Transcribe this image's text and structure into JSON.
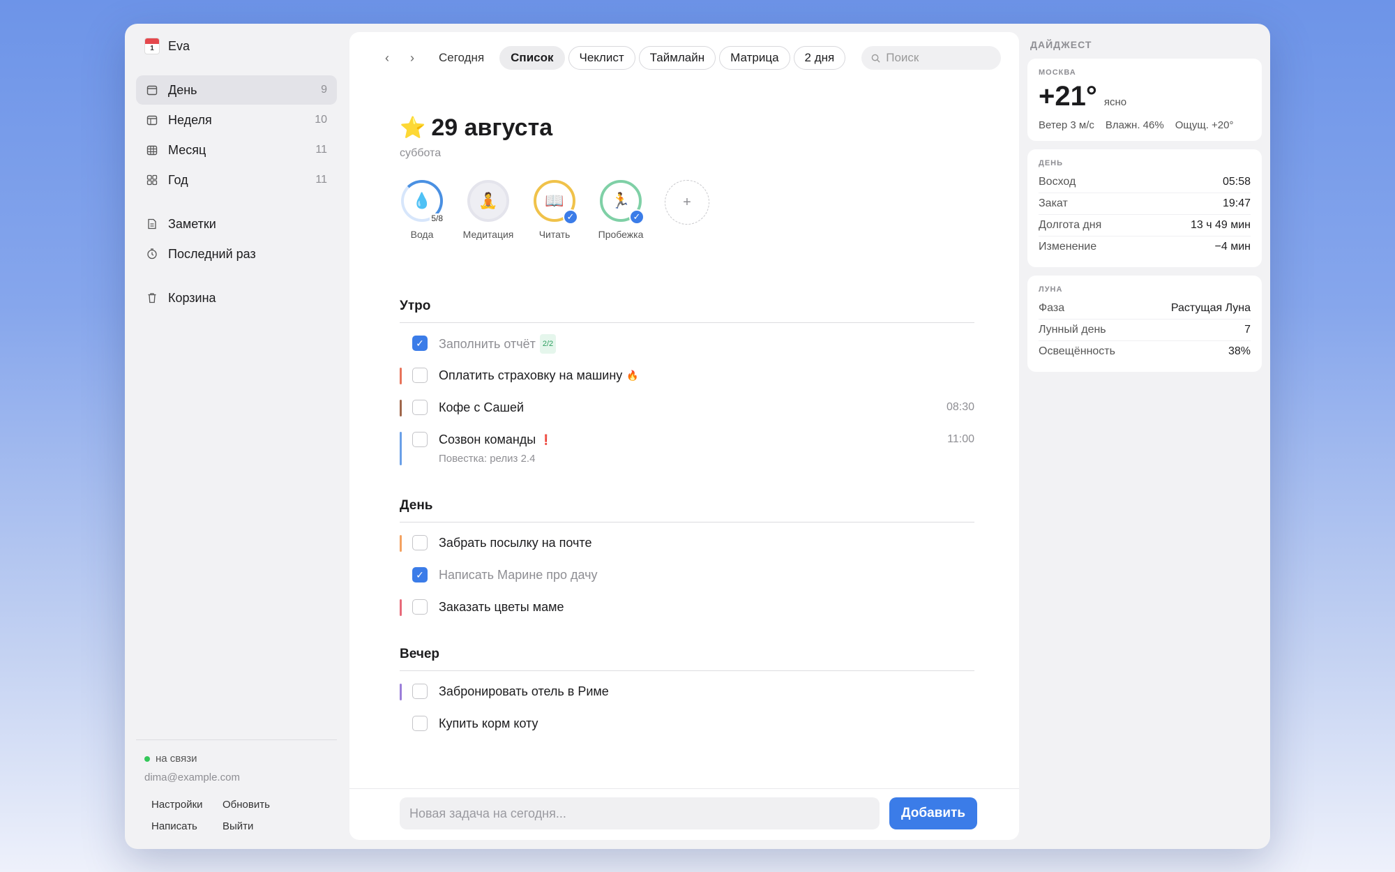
{
  "sidebar": {
    "app_name": "Eva",
    "calendar_icon_day": "1",
    "nav": [
      {
        "label": "День",
        "count": "9",
        "icon": "calendar-day-icon"
      },
      {
        "label": "Неделя",
        "count": "10",
        "icon": "calendar-week-icon"
      },
      {
        "label": "Месяц",
        "count": "11",
        "icon": "calendar-month-icon"
      },
      {
        "label": "Год",
        "count": "11",
        "icon": "grid-year-icon"
      }
    ],
    "nav2": [
      {
        "label": "Заметки",
        "icon": "note-icon"
      },
      {
        "label": "Последний раз",
        "icon": "clock-icon"
      }
    ],
    "nav3": [
      {
        "label": "Корзина",
        "icon": "trash-icon"
      }
    ],
    "status": "на связи",
    "email": "dima@example.com",
    "links": [
      "Настройки",
      "Обновить",
      "Написать",
      "Выйти"
    ]
  },
  "toolbar": {
    "today": "Сегодня",
    "views": [
      "Список",
      "Чеклист",
      "Таймлайн",
      "Матрица",
      "2 дня"
    ],
    "active_view": "Список",
    "search_placeholder": "Поиск"
  },
  "day": {
    "title": "29 августа",
    "weekday": "суббота"
  },
  "habits": [
    {
      "label": "Вода",
      "progress": "5/8",
      "emoji": "💧"
    },
    {
      "label": "Медитация",
      "emoji": "🧘"
    },
    {
      "label": "Читать",
      "emoji": "📖",
      "done": true
    },
    {
      "label": "Пробежка",
      "emoji": "🏃",
      "done": true
    }
  ],
  "add_habit_symbol": "+",
  "sections": [
    {
      "title": "Утро",
      "tasks": [
        {
          "title": "Заполнить отчёт",
          "badge": "2/2",
          "done": true
        },
        {
          "title": "Оплатить страховку на машину",
          "flag": "🔥",
          "bar": "#e8735a"
        },
        {
          "title": "Кофе с Сашей",
          "time": "08:30",
          "bar": "#a0674b"
        },
        {
          "title": "Созвон команды",
          "flag": "❗",
          "time": "11:00",
          "sub": "Повестка: релиз 2.4",
          "bar": "#6aa0e8"
        }
      ]
    },
    {
      "title": "День",
      "tasks": [
        {
          "title": "Забрать посылку на почте",
          "bar": "#f4a261"
        },
        {
          "title": "Написать Марине про дачу",
          "done": true
        },
        {
          "title": "Заказать цветы маме",
          "bar": "#e86a7a"
        }
      ]
    },
    {
      "title": "Вечер",
      "tasks": [
        {
          "title": "Забронировать отель в Риме",
          "bar": "#9b7ed9"
        },
        {
          "title": "Купить корм коту"
        }
      ]
    }
  ],
  "composer": {
    "placeholder": "Новая задача на сегодня...",
    "button": "Добавить"
  },
  "digest": {
    "heading": "ДАЙДЖЕСТ",
    "weather": {
      "city": "МОСКВА",
      "temp": "+21°",
      "condition": "ясно",
      "wind": "Ветер 3 м/с",
      "humidity": "Влажн. 46%",
      "feels": "Ощущ. +20°"
    },
    "day_card": {
      "caption": "ДЕНЬ",
      "rows": [
        {
          "k": "Восход",
          "v": "05:58"
        },
        {
          "k": "Закат",
          "v": "19:47"
        },
        {
          "k": "Долгота дня",
          "v": "13 ч 49 мин"
        },
        {
          "k": "Изменение",
          "v": "−4 мин"
        }
      ]
    },
    "moon_card": {
      "caption": "ЛУНА",
      "rows": [
        {
          "k": "Фаза",
          "v": "Растущая Луна"
        },
        {
          "k": "Лунный день",
          "v": "7"
        },
        {
          "k": "Освещённость",
          "v": "38%"
        }
      ]
    }
  },
  "colors": {
    "accent": "#3b7ce8",
    "online": "#34c759"
  }
}
